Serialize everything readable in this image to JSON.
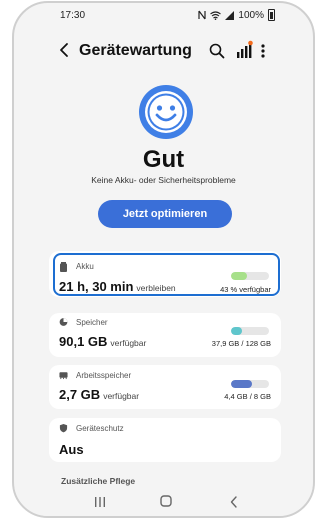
{
  "status_bar": {
    "time": "17:30",
    "battery": "100%"
  },
  "header": {
    "title": "Gerätewartung",
    "icons": [
      "back-arrow-icon",
      "search-icon",
      "signal-bars-icon",
      "more-vert-icon"
    ]
  },
  "status": {
    "icon": "smiley-face-icon",
    "title": "Gut",
    "subtitle": "Keine Akku- oder Sicherheitsprobleme"
  },
  "optimize_button": "Jetzt optimieren",
  "cards": {
    "battery": {
      "label": "Akku",
      "value": "21 h, 30 min",
      "suffix": "verbleiben",
      "caption": "43 % verfügbar",
      "fill_fraction": 0.43,
      "fill_color": "#a7e08a"
    },
    "storage": {
      "label": "Speicher",
      "value": "90,1 GB",
      "suffix": "verfügbar",
      "caption": "37,9 GB / 128 GB",
      "fill_fraction": 0.3,
      "fill_color": "#5fc6cc"
    },
    "memory": {
      "label": "Arbeitsspeicher",
      "value": "2,7 GB",
      "suffix": "verfügbar",
      "caption": "4,4 GB / 8 GB",
      "fill_fraction": 0.55,
      "fill_color": "#5a78c8"
    },
    "protection": {
      "label": "Geräteschutz",
      "value": "Aus"
    }
  },
  "additional_section": "Zusätzliche Pflege",
  "colors": {
    "accent": "#3a6fd8",
    "highlight": "#1d6ed1",
    "background": "#f4f4f4"
  },
  "nav_bar": [
    "recent-apps-icon",
    "home-icon",
    "back-icon"
  ]
}
